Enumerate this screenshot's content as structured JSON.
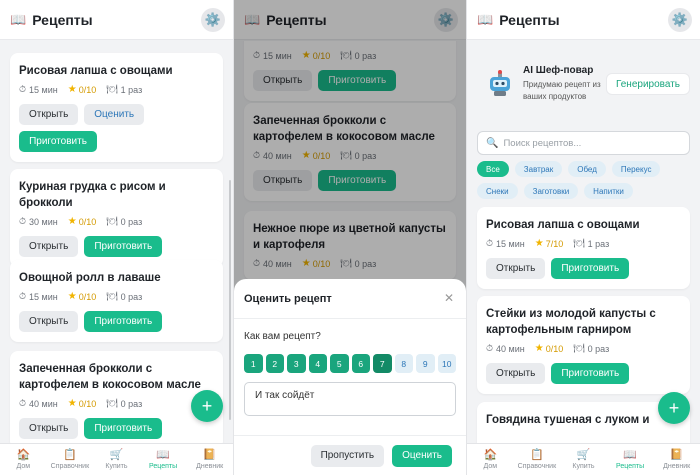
{
  "app": {
    "title": "Рецепты",
    "book_icon": "📖",
    "gear_icon": "⚙️"
  },
  "nav": [
    {
      "label": "Дом",
      "icon": "🏠"
    },
    {
      "label": "Справочник",
      "icon": "📋"
    },
    {
      "label": "Купить",
      "icon": "🛒"
    },
    {
      "label": "Рецепты",
      "icon": "📖"
    },
    {
      "label": "Дневник",
      "icon": "📔"
    }
  ],
  "actions": {
    "open": "Открыть",
    "cook": "Приготовить",
    "rate": "Оценить",
    "add": "+"
  },
  "screen1": {
    "cards": [
      {
        "title": "Рисовая лапша с овощами",
        "time": "15 мин",
        "rating": "0/10",
        "count": "1 раз"
      },
      {
        "title": "Куриная грудка с рисом и брокколи",
        "time": "30 мин",
        "rating": "0/10",
        "count": "0 раз"
      },
      {
        "title": "Овощной ролл в лаваше",
        "time": "15 мин",
        "rating": "0/10",
        "count": "0 раз"
      },
      {
        "title": "Запеченная брокколи с картофелем в кокосовом масле",
        "time": "40 мин",
        "rating": "0/10",
        "count": "0 раз"
      }
    ]
  },
  "screen2": {
    "cards": [
      {
        "time": "15 мин",
        "rating": "0/10",
        "count": "0 раз"
      },
      {
        "title": "Запеченная брокколи с картофелем в кокосовом масле",
        "time": "40 мин",
        "rating": "0/10",
        "count": "0 раз"
      },
      {
        "title": "Нежное пюре из цветной капусты и картофеля",
        "time": "40 мин",
        "rating": "0/10",
        "count": "0 раз"
      }
    ],
    "modal": {
      "title": "Оценить рецепт",
      "close_icon": "✕",
      "question": "Как вам рецепт?",
      "scale": [
        "1",
        "2",
        "3",
        "4",
        "5",
        "6",
        "7",
        "8",
        "9",
        "10"
      ],
      "selected": 7,
      "comment": "И так сойдёт",
      "skip": "Пропустить",
      "submit": "Оценить"
    }
  },
  "screen3": {
    "ai": {
      "title": "AI Шеф-повар",
      "subtitle": "Придумаю рецепт из ваших продуктов",
      "button": "Генерировать"
    },
    "search": {
      "placeholder": "Поиск рецептов...",
      "icon": "🔍"
    },
    "chips": [
      "Все",
      "Завтрак",
      "Обед",
      "Перекус",
      "Снеки",
      "Заготовки",
      "Напитки"
    ],
    "active_chip": "Все",
    "cards": [
      {
        "title": "Рисовая лапша с овощами",
        "time": "15 мин",
        "rating": "7/10",
        "count": "1 раз"
      },
      {
        "title": "Стейки из молодой капусты с картофельным гарниром",
        "time": "40 мин",
        "rating": "0/10",
        "count": "0 раз"
      },
      {
        "title": "Говядина тушеная с луком и"
      }
    ]
  },
  "colors": {
    "accent": "#1abc8c",
    "chip_bg": "#e1eef6",
    "chip_text": "#2d77b8",
    "star": "#f1b400"
  }
}
